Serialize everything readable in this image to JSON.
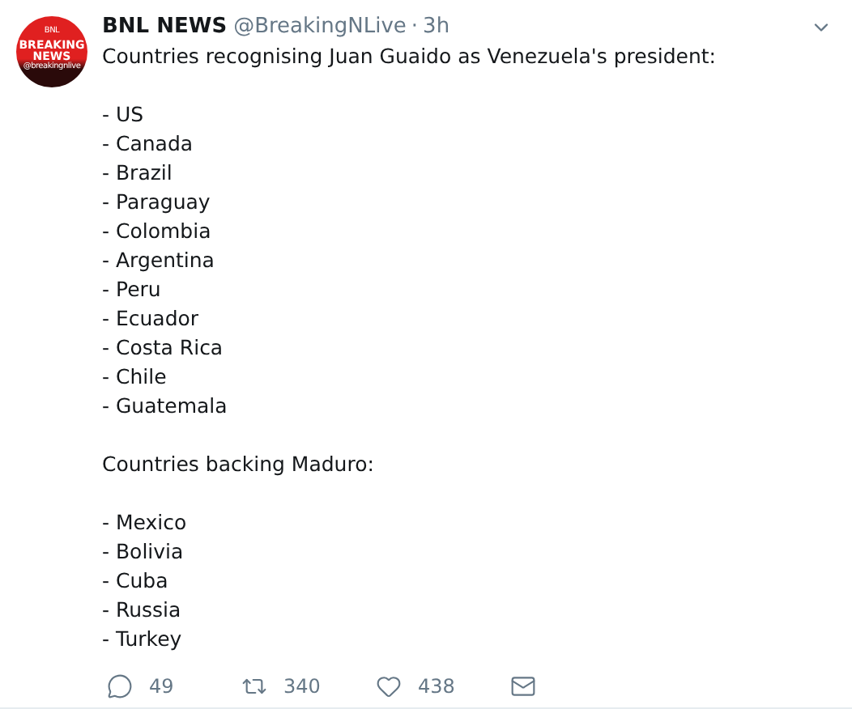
{
  "avatar": {
    "lines": [
      "BNL",
      "BREAKING",
      "NEWS",
      "@breakingnlive"
    ]
  },
  "author": {
    "name": "BNL NEWS",
    "handle": "@BreakingNLive",
    "separator": "·",
    "time": "3h"
  },
  "intro": "Countries recognising Juan Guaido as Venezuela's president:",
  "list_1": [
    "- US",
    "- Canada",
    "- Brazil",
    "- Paraguay",
    "- Colombia",
    "- Argentina",
    "- Peru",
    "- Ecuador",
    "- Costa Rica",
    "- Chile",
    "- Guatemala"
  ],
  "heading_2": "Countries backing Maduro:",
  "list_2": [
    "- Mexico",
    "- Bolivia",
    "- Cuba",
    "- Russia",
    "- Turkey"
  ],
  "actions": [
    {
      "kind": "reply",
      "count": "49"
    },
    {
      "kind": "retweet",
      "count": "340"
    },
    {
      "kind": "like",
      "count": "438"
    },
    {
      "kind": "message"
    }
  ]
}
